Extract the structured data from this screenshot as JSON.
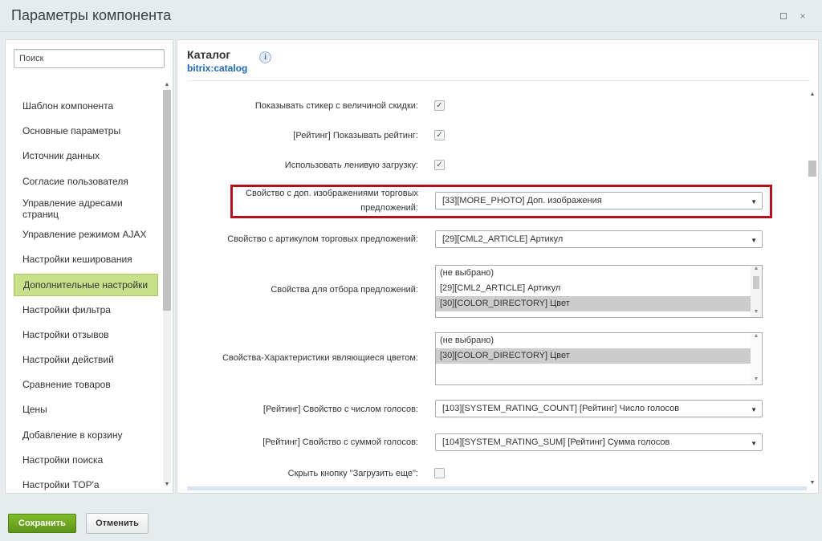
{
  "window": {
    "title": "Параметры компонента",
    "maximize_icon": "maximize-icon",
    "close_symbol": "×"
  },
  "sidebar": {
    "search_placeholder": "Поиск",
    "items": [
      {
        "label": "Шаблон компонента"
      },
      {
        "label": "Основные параметры"
      },
      {
        "label": "Источник данных"
      },
      {
        "label": "Согласие пользователя"
      },
      {
        "label": "Управление адресами страниц"
      },
      {
        "label": "Управление режимом AJAX"
      },
      {
        "label": "Настройки кеширования"
      },
      {
        "label": "Дополнительные настройки"
      },
      {
        "label": "Настройки фильтра"
      },
      {
        "label": "Настройки отзывов"
      },
      {
        "label": "Настройки действий"
      },
      {
        "label": "Сравнение товаров"
      },
      {
        "label": "Цены"
      },
      {
        "label": "Добавление в корзину"
      },
      {
        "label": "Настройки поиска"
      },
      {
        "label": "Настройки TOP'а"
      }
    ],
    "active_item": "Дополнительные настройки",
    "active_color": "#c7e089"
  },
  "main": {
    "title": "Каталог",
    "subtitle": "bitrix:catalog",
    "info_icon": "i",
    "rows": {
      "show_discount_sticker": {
        "label": "Показывать стикер с величиной скидки:",
        "checked": true
      },
      "show_rating": {
        "label": "[Рейтинг] Показывать рейтинг:",
        "checked": true
      },
      "lazy_load": {
        "label": "Использовать ленивую загрузку:",
        "checked": true
      },
      "offers_photo_prop": {
        "label_line1": "Свойство с доп. изображениями торговых",
        "label_line2": "предложений:",
        "value": "[33][MORE_PHOTO] Доп. изображения"
      },
      "offers_article_prop": {
        "label": "Свойство с артикулом торговых предложений:",
        "value": "[29][CML2_ARTICLE] Артикул"
      },
      "offers_filter_props": {
        "label": "Свойства для отбора предложений:",
        "options": [
          "(не выбрано)",
          "[29][CML2_ARTICLE] Артикул",
          "[30][COLOR_DIRECTORY] Цвет"
        ],
        "selected": "[30][COLOR_DIRECTORY] Цвет"
      },
      "color_props": {
        "label": "Свойства-Характеристики являющиеся цветом:",
        "options": [
          "(не выбрано)",
          "[30][COLOR_DIRECTORY] Цвет"
        ],
        "selected": "[30][COLOR_DIRECTORY] Цвет"
      },
      "rating_count_prop": {
        "label": "[Рейтинг] Свойство с числом голосов:",
        "value": "[103][SYSTEM_RATING_COUNT] [Рейтинг] Число голосов"
      },
      "rating_sum_prop": {
        "label": "[Рейтинг] Свойство с суммой голосов:",
        "value": "[104][SYSTEM_RATING_SUM] [Рейтинг] Сумма голосов"
      },
      "hide_load_more": {
        "label": "Скрыть кнопку \"Загрузить еще\":",
        "checked": false
      }
    },
    "highlight_color": "#b5111c"
  },
  "footer": {
    "save_label": "Сохранить",
    "cancel_label": "Отменить",
    "save_color": "#6ba11c"
  }
}
